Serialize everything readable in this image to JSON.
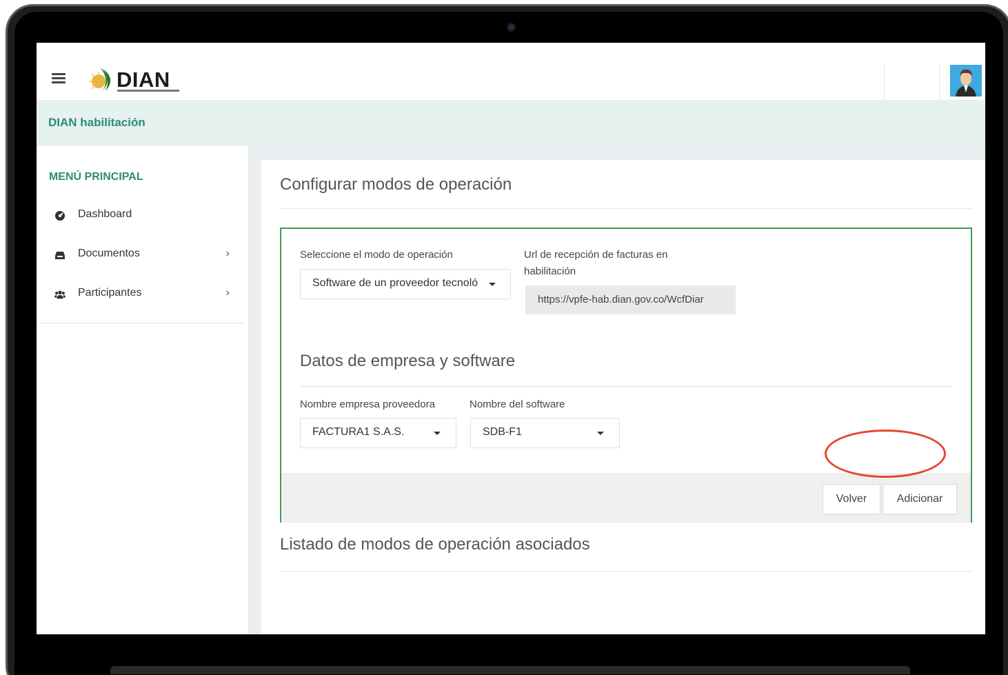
{
  "header": {
    "logo_text": "DIAN",
    "subheader_title": "DIAN habilitación"
  },
  "sidebar": {
    "heading": "MENÚ PRINCIPAL",
    "items": [
      {
        "label": "Dashboard",
        "icon": "dashboard-icon",
        "has_submenu": false
      },
      {
        "label": "Documentos",
        "icon": "inbox-icon",
        "has_submenu": true
      },
      {
        "label": "Participantes",
        "icon": "users-icon",
        "has_submenu": true
      }
    ]
  },
  "main": {
    "title": "Configurar modos de operación",
    "mode_label": "Seleccione el modo de operación",
    "mode_value": "Software de un proveedor tecnoló",
    "url_label_line1": "Url de recepción de facturas en",
    "url_label_line2": "habilitación",
    "url_value": "https://vpfe-hab.dian.gov.co/WcfDiar",
    "section_title": "Datos de empresa y software",
    "company_label": "Nombre empresa proveedora",
    "company_value": "FACTURA1 S.A.S.",
    "software_label": "Nombre del software",
    "software_value": "SDB-F1",
    "back_button": "Volver",
    "add_button": "Adicionar",
    "list_title": "Listado de modos de operación asociados"
  },
  "colors": {
    "accent_green": "#2e8b77",
    "box_border": "#3e9a5a",
    "highlight": "#e8452e"
  }
}
